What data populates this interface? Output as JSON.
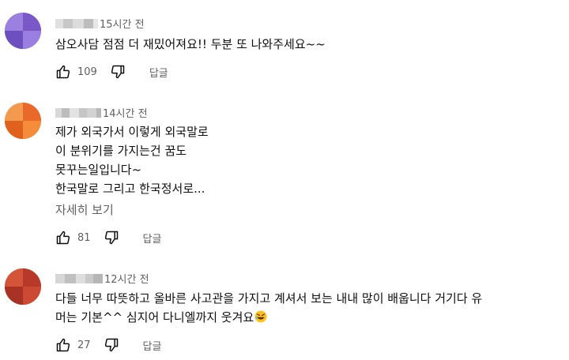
{
  "comments": [
    {
      "time": "15시간 전",
      "lines": [
        "삼오사담 점점 더 재밌어져요!! 두분 또 나와주세요~~"
      ],
      "likes": "109",
      "reply_label": "답글",
      "avatar_color": "#8a6ad6"
    },
    {
      "time": "14시간 전",
      "lines": [
        "제가 외국가서 이렇게 외국말로",
        "이 분위기를 가지는건 꿈도",
        "못꾸는일입니다~",
        "한국말로 그리고 한국정서로..."
      ],
      "more_label": "자세히 보기",
      "likes": "81",
      "reply_label": "답글",
      "avatar_color": "#f07a2e"
    },
    {
      "time": "12시간 전",
      "lines": [
        "다들 너무 따뜻하고 올바른 사고관을 가지고 계셔서 보는 내내 많이 배웁니다 거기다 유",
        "머는 기본^^ 심지어 다니엘까지 웃겨요"
      ],
      "likes": "27",
      "reply_label": "답글",
      "avatar_color": "#c0432e"
    }
  ]
}
